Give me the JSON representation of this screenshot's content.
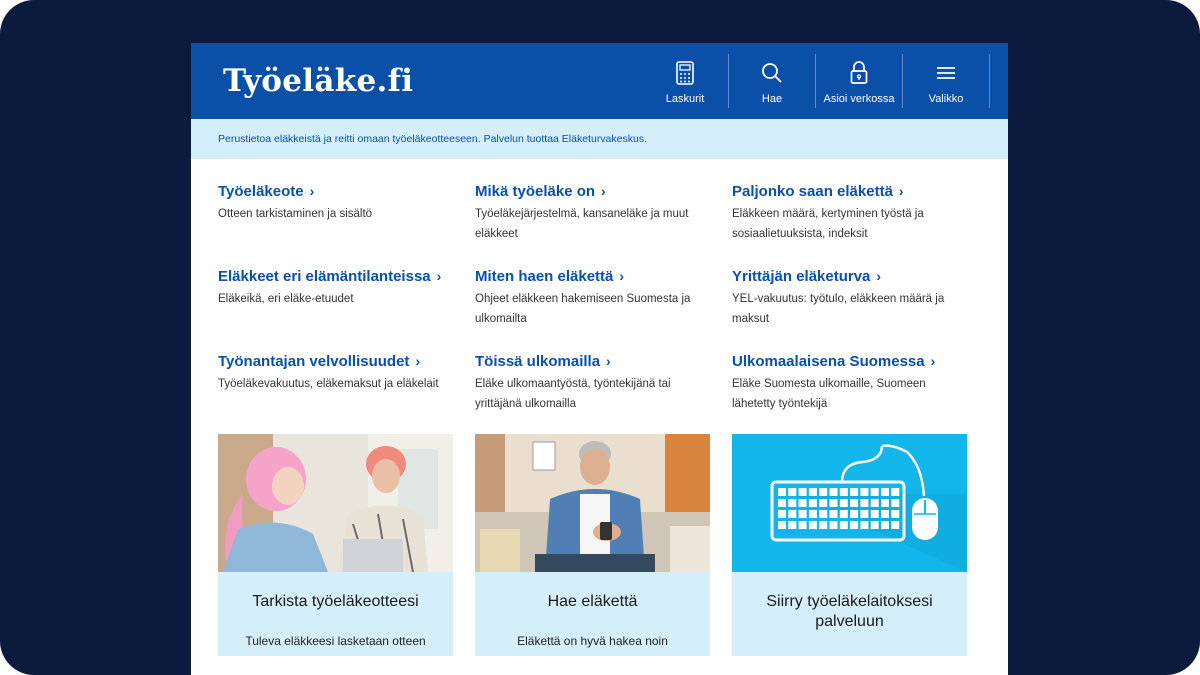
{
  "header": {
    "logo": "Työeläke.fi",
    "nav": [
      {
        "label": "Laskurit",
        "icon": "calculator-icon"
      },
      {
        "label": "Hae",
        "icon": "search-icon"
      },
      {
        "label": "Asioi verkossa",
        "icon": "lock-icon"
      },
      {
        "label": "Valikko",
        "icon": "menu-icon"
      }
    ]
  },
  "info_bar": "Perustietoa eläkkeistä ja reitti omaan työeläkeotteeseen. Palvelun tuottaa Eläketurvakeskus.",
  "links": [
    {
      "title": "Työeläkeote",
      "desc": "Otteen tarkistaminen ja sisältö"
    },
    {
      "title": "Mikä työeläke on",
      "desc": "Työeläkejärjestelmä, kansaneläke ja muut eläkkeet"
    },
    {
      "title": "Paljonko saan eläkettä",
      "desc": "Eläkkeen määrä, kertyminen työstä ja sosiaalietuuksista, indeksit"
    },
    {
      "title": "Eläkkeet eri elämäntilanteissa",
      "desc": "Eläkeikä, eri eläke-etuudet"
    },
    {
      "title": "Miten haen eläkettä",
      "desc": "Ohjeet eläkkeen hakemiseen Suomesta ja ulkomailta"
    },
    {
      "title": "Yrittäjän eläketurva",
      "desc": "YEL-vakuutus: työtulo, eläkkeen määrä ja maksut"
    },
    {
      "title": "Työnantajan velvollisuudet",
      "desc": "Työeläkevakuutus, eläkemaksut ja eläkelait"
    },
    {
      "title": "Töissä ulkomailla",
      "desc": "Eläke ulkomaantyöstä, työntekijänä tai yrittäjänä ulkomailla"
    },
    {
      "title": "Ulkomaalaisena Suomessa",
      "desc": "Eläke Suomesta ulkomaille, Suomeen lähetetty työntekijä"
    }
  ],
  "cards": [
    {
      "title": "Tarkista työeläkeotteesi",
      "sub": "Tuleva eläkkeesi lasketaan otteen"
    },
    {
      "title": "Hae eläkettä",
      "sub": "Eläkettä on hyvä hakea noin"
    },
    {
      "title": "Siirry työeläkelaitoksesi palveluun",
      "sub": ""
    }
  ],
  "colors": {
    "brand": "#0a4fa8",
    "light": "#d4eefa",
    "frame": "#0c1a3d"
  }
}
